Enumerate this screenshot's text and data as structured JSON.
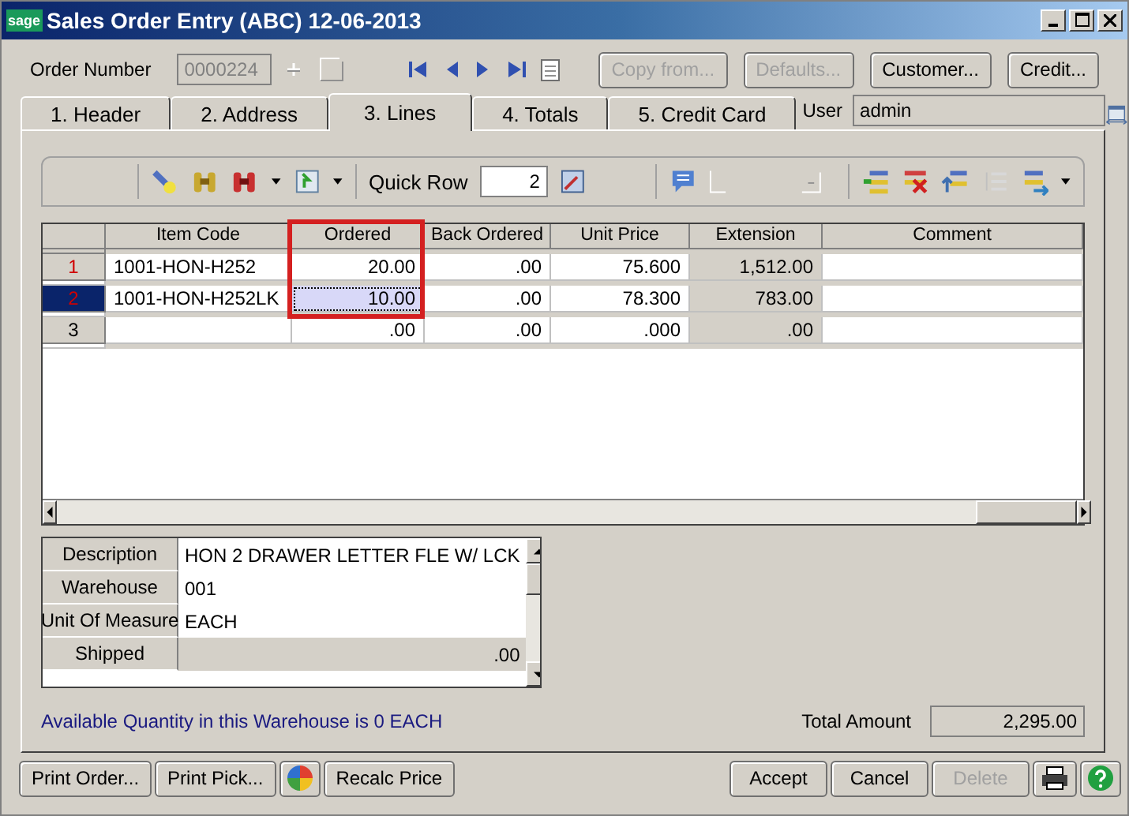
{
  "window": {
    "title": "Sales Order Entry (ABC) 12-06-2013",
    "logo": "sage"
  },
  "order_number": {
    "label": "Order Number",
    "value": "0000224"
  },
  "header_buttons": [
    {
      "label": "Copy from...",
      "disabled": true
    },
    {
      "label": "Defaults...",
      "disabled": true
    },
    {
      "label": "Customer...",
      "disabled": false
    },
    {
      "label": "Credit...",
      "disabled": false
    }
  ],
  "tabs": [
    {
      "label": "1. Header",
      "selected": false
    },
    {
      "label": "2. Address",
      "selected": false
    },
    {
      "label": "3. Lines",
      "selected": true
    },
    {
      "label": "4. Totals",
      "selected": false
    },
    {
      "label": "5. Credit Card",
      "selected": false
    }
  ],
  "user": {
    "label": "User",
    "value": "admin"
  },
  "quick_row": {
    "label": "Quick Row",
    "value": "2"
  },
  "grid": {
    "columns": [
      {
        "label": "Item Code",
        "highlighted": false,
        "readonly": false
      },
      {
        "label": "Ordered",
        "highlighted": true,
        "readonly": false
      },
      {
        "label": "Back Ordered",
        "highlighted": false,
        "readonly": false
      },
      {
        "label": "Unit Price",
        "highlighted": false,
        "readonly": false
      },
      {
        "label": "Extension",
        "highlighted": false,
        "readonly": true
      },
      {
        "label": "Comment",
        "highlighted": false,
        "readonly": false
      }
    ],
    "rows": [
      {
        "number": "1",
        "selected": false,
        "modified": true,
        "cells": [
          "1001-HON-H252",
          "20.00",
          ".00",
          "75.600",
          "1,512.00",
          null
        ]
      },
      {
        "number": "2",
        "selected": true,
        "modified": true,
        "cells": [
          "1001-HON-H252LK",
          "10.00",
          ".00",
          "78.300",
          "783.00",
          null
        ]
      },
      {
        "number": "3",
        "selected": false,
        "modified": false,
        "cells": [
          null,
          ".00",
          ".00",
          ".000",
          ".00",
          null
        ]
      }
    ]
  },
  "details": [
    {
      "label": "Description",
      "value": "HON 2 DRAWER LETTER FLE W/ LCK",
      "readonly": false
    },
    {
      "label": "Warehouse",
      "value": "001",
      "readonly": false
    },
    {
      "label": "Unit Of Measure",
      "value": "EACH",
      "readonly": false
    },
    {
      "label": "Shipped",
      "value": ".00",
      "readonly": true
    }
  ],
  "status_message": "Available Quantity in this Warehouse is 0 EACH",
  "total": {
    "label": "Total Amount",
    "value": "2,295.00"
  },
  "footer_left": [
    {
      "kind": "text",
      "label": "Print Order..."
    },
    {
      "kind": "text",
      "label": "Print Pick..."
    },
    {
      "kind": "icon"
    },
    {
      "kind": "text",
      "label": "Recalc Price"
    }
  ],
  "footer_right": [
    {
      "label": "Accept",
      "disabled": false
    },
    {
      "label": "Cancel",
      "disabled": false
    },
    {
      "label": "Delete",
      "disabled": true
    }
  ]
}
